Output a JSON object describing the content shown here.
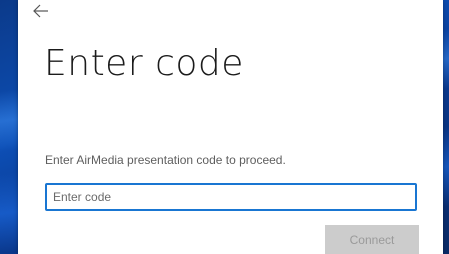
{
  "dialog": {
    "title": "Enter code",
    "prompt": "Enter AirMedia presentation code to proceed.",
    "code_input": {
      "value": "",
      "placeholder": "Enter code"
    },
    "connect_label": "Connect",
    "back_icon": "back-arrow-icon"
  },
  "colors": {
    "accent": "#1976d2",
    "button_disabled_bg": "#cccccc",
    "button_disabled_text": "#9a9a9a",
    "desktop_bg": "#0d4fb6"
  }
}
